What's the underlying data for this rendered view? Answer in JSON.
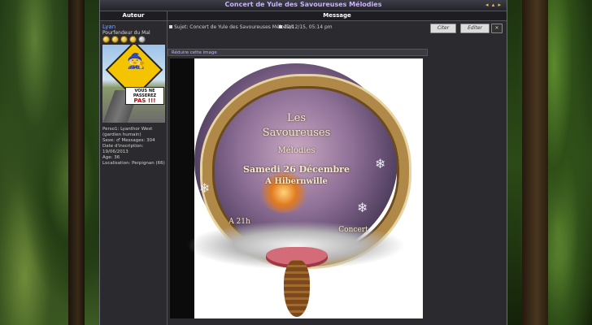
{
  "topic": {
    "title": "Concert de Yule des Savoureuses Mélodies",
    "nav": "◂ ▴ ▸"
  },
  "columns": {
    "author": "Auteur",
    "message": "Message"
  },
  "author": {
    "name": "Lyan",
    "rank": "Pourfendeur du Mal",
    "stars_gold": 4,
    "stars_total": 5,
    "avatar_text": {
      "line1": "VOUS NE",
      "line2": "PASSEREZ",
      "line3": "PAS !!!"
    },
    "profile": [
      "Perso1: Lyanthor West",
      "(gardien humain)",
      "Sexe: ♂ Messages: 304",
      "Date d'inscription: 19/06/2013",
      "Age: 36",
      "Localisation: Perpignan (66)"
    ]
  },
  "post": {
    "subject": "Sujet: Concert de Yule des Savoureuses Mélodies",
    "date": "22/12/15, 05:14 pm",
    "buttons": {
      "quote": "Citer",
      "edit": "Editer",
      "delete": "✕"
    },
    "resize_link": "Réduire cette image"
  },
  "poster": {
    "line1": "Les",
    "line2": "Savoureuses",
    "line3": "Mélodies",
    "line4": "Samedi 26 Décembre",
    "line5": "A Hibernwille",
    "line6": "A 21h",
    "line7": "Concert"
  }
}
